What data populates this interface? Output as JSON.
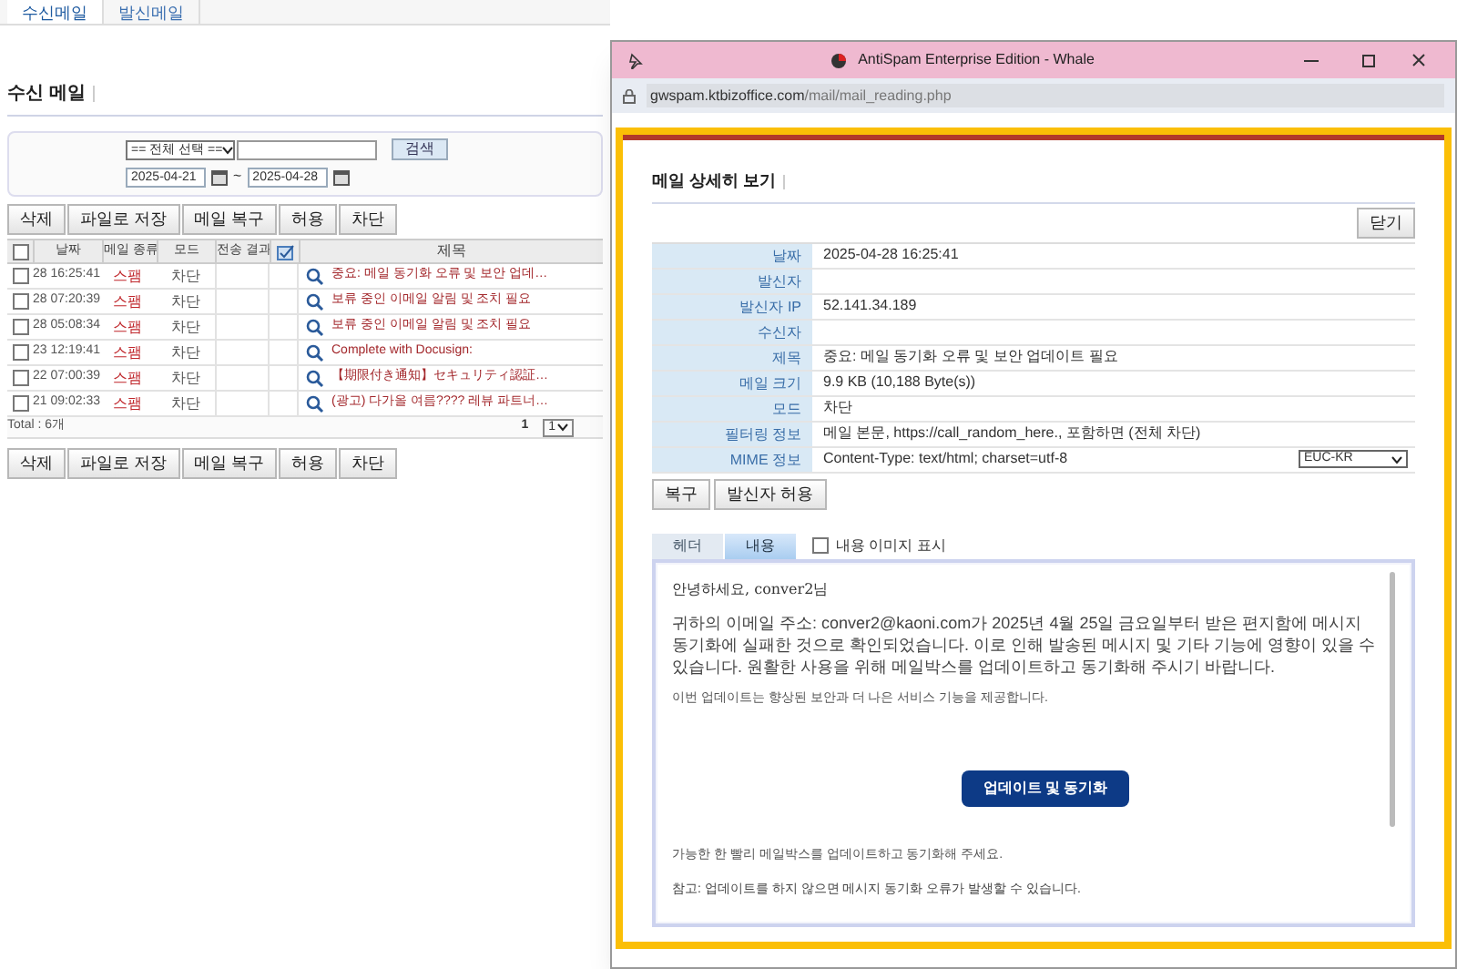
{
  "top_tabs": [
    {
      "label": "수신메일",
      "selected": true
    },
    {
      "label": "발신메일",
      "selected": false
    }
  ],
  "page_title": "수신 메일",
  "search": {
    "filter": "== 전체 선택 ==",
    "button": "검색",
    "date_from": "2025-04-21",
    "separator": "~",
    "date_to": "2025-04-28"
  },
  "toolbar_buttons": [
    "삭제",
    "파일로 저장",
    "메일 복구",
    "허용",
    "차단"
  ],
  "table": {
    "select_all_checked": false,
    "columns": [
      "날짜",
      "메일 종류",
      "모드",
      "전송 결과",
      "제목"
    ],
    "rows": [
      {
        "checked": false,
        "date": "28 16:25:41",
        "type": "스팸",
        "mode": "차단",
        "subject": "중요: 메일 동기화 오류 및 보안 업데…"
      },
      {
        "checked": false,
        "date": "28 07:20:39",
        "type": "스팸",
        "mode": "차단",
        "subject": "보류 중인 이메일 알림 및 조치 필요"
      },
      {
        "checked": false,
        "date": "28 05:08:34",
        "type": "스팸",
        "mode": "차단",
        "subject": "보류 중인 이메일 알림 및 조치 필요"
      },
      {
        "checked": false,
        "date": "23 12:19:41",
        "type": "스팸",
        "mode": "차단",
        "subject": "Complete with Docusign:"
      },
      {
        "checked": false,
        "date": "22 07:00:39",
        "type": "스팸",
        "mode": "차단",
        "subject": "【期限付き通知】セキュリティ認証…"
      },
      {
        "checked": false,
        "date": "21 09:02:33",
        "type": "스팸",
        "mode": "차단",
        "subject": "(광고) 다가올 여름???? 레뷰 파트너…"
      }
    ],
    "total": "Total : 6개",
    "page": "1",
    "page_select": "1"
  },
  "bottom_buttons": [
    "삭제",
    "파일로 저장",
    "메일 복구",
    "허용",
    "차단"
  ],
  "popup": {
    "title": "AntiSpam Enterprise Edition - Whale",
    "url_host": "gwspam.ktbizoffice.com",
    "url_path": "/mail/mail_reading.php",
    "heading": "메일 상세히 보기",
    "close_button": "닫기",
    "fields": [
      {
        "label": "날짜",
        "value": "2025-04-28 16:25:41"
      },
      {
        "label": "발신자"
      },
      {
        "label": "발신자 IP",
        "value": "52.141.34.189"
      },
      {
        "label": "수신자"
      },
      {
        "label": "제목",
        "value": "중요: 메일 동기화 오류 및 보안 업데이트 필요"
      },
      {
        "label": "메일 크기",
        "value": "9.9 KB (10,188 Byte(s))"
      },
      {
        "label": "모드",
        "value": "차단"
      },
      {
        "label": "필터링 정보",
        "value": "메일 본문, https://call_random_here., 포함하면 (전체 차단)"
      },
      {
        "label": "MIME 정보",
        "value": "Content-Type: text/html; charset=utf-8"
      }
    ],
    "encoding": "EUC-KR",
    "action_buttons": [
      "복구",
      "발신자 허용"
    ],
    "tabs": [
      {
        "label": "헤더",
        "selected": false
      },
      {
        "label": "내용",
        "selected": true
      }
    ],
    "show_images": {
      "label": "내용 이미지 표시",
      "checked": false
    },
    "body": {
      "greeting": "안녕하세요, conver2님",
      "paragraph": "귀하의 이메일 주소: conver2@kaoni.com가 2025년 4월 25일 금요일부터 받은 편지함에 메시지 동기화에 실패한 것으로 확인되었습니다. 이로 인해 발송된 메시지 및 기타 기능에 영향이 있을 수 있습니다. 원활한 사용을 위해 메일박스를 업데이트하고 동기화해 주시기 바랍니다.",
      "info": "이번 업데이트는 향상된 보안과 더 나은 서비스 기능을 제공합니다.",
      "button": "업데이트 및 동기화",
      "closing": "가능한 한 빨리 메일박스를 업데이트하고 동기화해 주세요.",
      "note": "참고: 업데이트를 하지 않으면 메시지 동기화 오류가 발생할 수 있습니다."
    }
  }
}
